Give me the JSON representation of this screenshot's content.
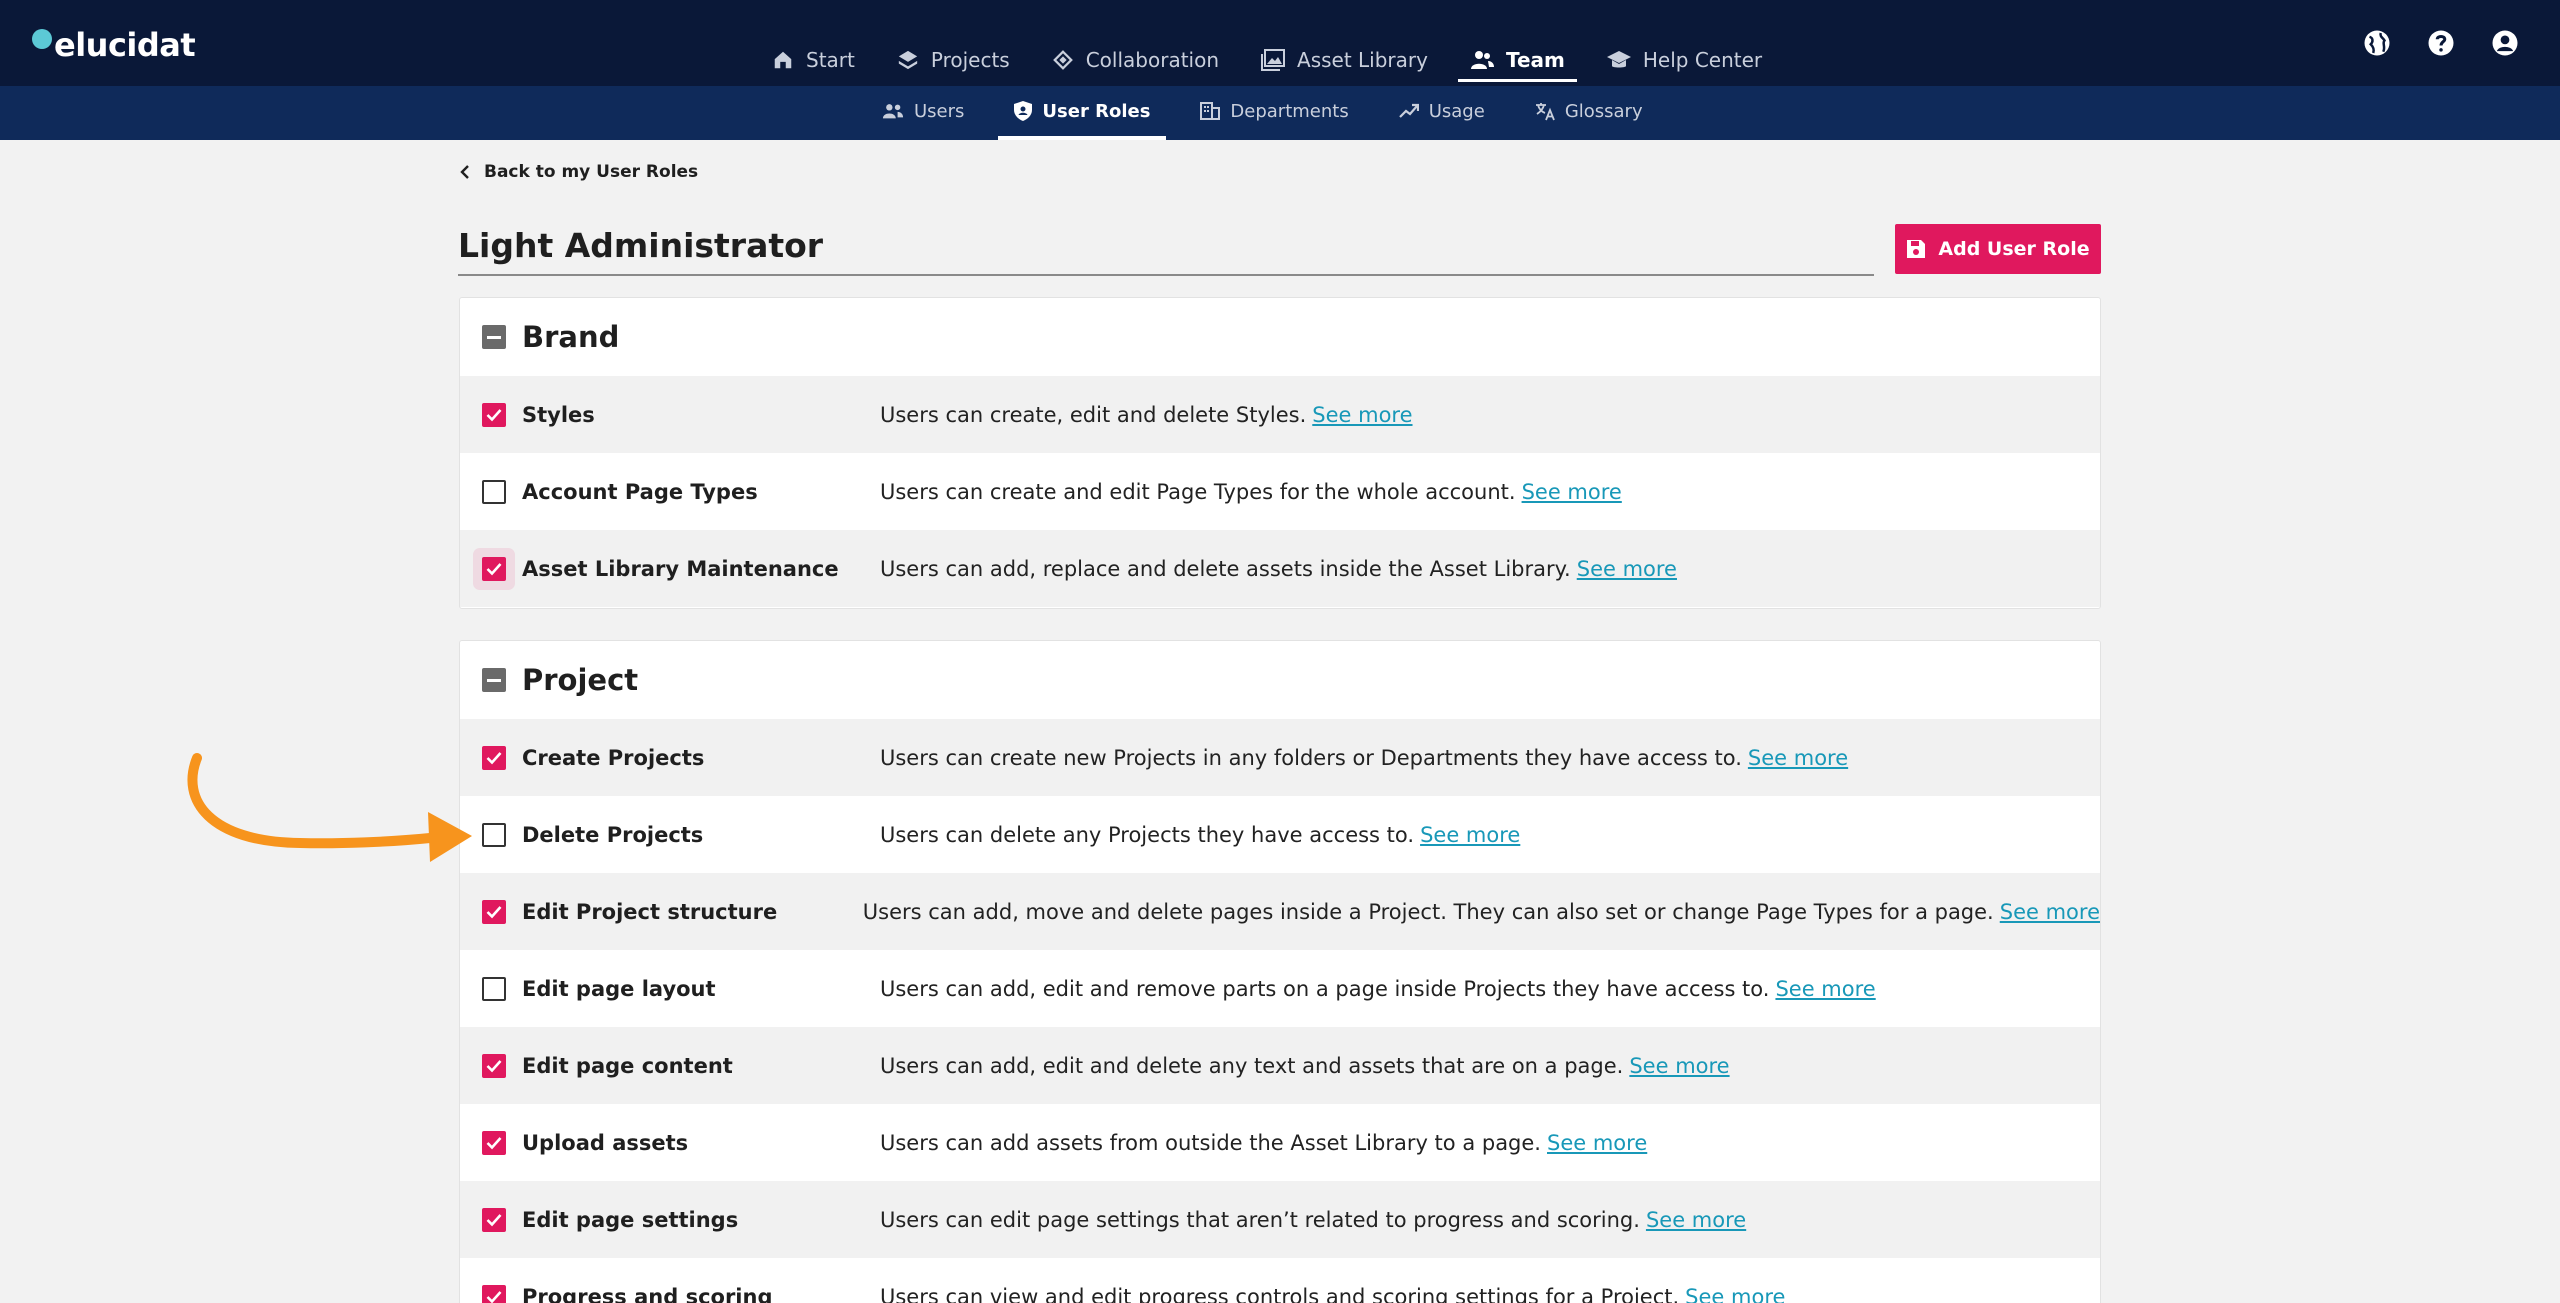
{
  "app": {
    "logo_text": "elucidat"
  },
  "main_nav": [
    {
      "label": "Start",
      "icon": "home-icon"
    },
    {
      "label": "Projects",
      "icon": "layers-icon"
    },
    {
      "label": "Collaboration",
      "icon": "collaboration-icon"
    },
    {
      "label": "Asset Library",
      "icon": "image-library-icon"
    },
    {
      "label": "Team",
      "icon": "team-icon",
      "active": true
    },
    {
      "label": "Help Center",
      "icon": "graduation-cap-icon"
    }
  ],
  "sub_nav": [
    {
      "label": "Users",
      "icon": "users-icon"
    },
    {
      "label": "User Roles",
      "icon": "shield-user-icon",
      "active": true
    },
    {
      "label": "Departments",
      "icon": "building-icon"
    },
    {
      "label": "Usage",
      "icon": "trend-icon"
    },
    {
      "label": "Glossary",
      "icon": "translate-icon"
    }
  ],
  "page": {
    "back_label": "Back to my User Roles",
    "role_name": "Light Administrator",
    "add_button_label": "Add User Role",
    "see_more": "See more"
  },
  "sections": [
    {
      "title": "Brand",
      "rows": [
        {
          "label": "Styles",
          "desc": "Users can create, edit and delete Styles.",
          "checked": true
        },
        {
          "label": "Account Page Types",
          "desc": "Users can create and edit Page Types for the whole account.",
          "checked": false
        },
        {
          "label": "Asset Library Maintenance",
          "desc": "Users can add, replace and delete assets inside the Asset Library.",
          "checked": true,
          "focused": true
        }
      ]
    },
    {
      "title": "Project",
      "rows": [
        {
          "label": "Create Projects",
          "desc": "Users can create new Projects in any folders or Departments they have access to.",
          "checked": true
        },
        {
          "label": "Delete Projects",
          "desc": "Users can delete any Projects they have access to.",
          "checked": false
        },
        {
          "label": "Edit Project structure",
          "desc": "Users can add, move and delete pages inside a Project. They can also set or change Page Types for a page.",
          "checked": true
        },
        {
          "label": "Edit page layout",
          "desc": "Users can add, edit and remove parts on a page inside Projects they have access to.",
          "checked": false
        },
        {
          "label": "Edit page content",
          "desc": "Users can add, edit and delete any text and assets that are on a page.",
          "checked": true
        },
        {
          "label": "Upload assets",
          "desc": "Users can add assets from outside the Asset Library to a page.",
          "checked": true
        },
        {
          "label": "Edit page settings",
          "desc": "Users can edit page settings that aren’t related to progress and scoring.",
          "checked": true
        },
        {
          "label": "Progress and scoring",
          "desc": "Users can view and edit progress controls and scoring settings for a Project.",
          "checked": true
        }
      ]
    }
  ],
  "colors": {
    "nav_bg": "#0a1838",
    "subnav_bg": "#0f2a5a",
    "accent": "#e0185e",
    "link": "#1898b8",
    "arrow": "#f7941d"
  }
}
